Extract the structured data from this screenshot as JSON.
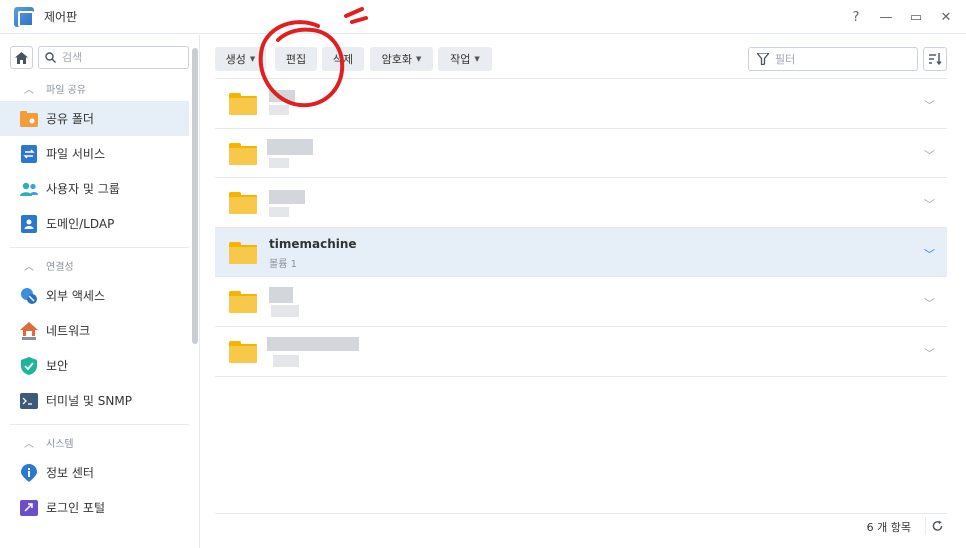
{
  "window": {
    "title": "제어판",
    "help_label": "?",
    "minimize_label": "—",
    "maximize_label": "▭",
    "close_label": "✕"
  },
  "sidebar": {
    "search_placeholder": "검색",
    "sections": [
      {
        "title": "파일 공유",
        "items": [
          {
            "label": "공유 폴더",
            "icon": "shared-folder-icon",
            "active": true
          },
          {
            "label": "파일 서비스",
            "icon": "file-services-icon"
          },
          {
            "label": "사용자 및 그룹",
            "icon": "users-icon"
          },
          {
            "label": "도메인/LDAP",
            "icon": "domain-icon"
          }
        ]
      },
      {
        "title": "연결성",
        "items": [
          {
            "label": "외부 액세스",
            "icon": "external-access-icon"
          },
          {
            "label": "네트워크",
            "icon": "network-icon"
          },
          {
            "label": "보안",
            "icon": "security-shield-icon"
          },
          {
            "label": "터미널 및 SNMP",
            "icon": "terminal-icon"
          }
        ]
      },
      {
        "title": "시스템",
        "items": [
          {
            "label": "정보 센터",
            "icon": "info-icon"
          },
          {
            "label": "로그인 포털",
            "icon": "login-portal-icon"
          }
        ]
      }
    ]
  },
  "toolbar": {
    "create_label": "생성",
    "edit_label": "편집",
    "delete_label": "삭제",
    "encrypt_label": "암호화",
    "action_label": "작업",
    "filter_placeholder": "필터"
  },
  "folders": [
    {
      "name": "",
      "sub": "",
      "redacted": true
    },
    {
      "name": "",
      "sub": "",
      "redacted": true
    },
    {
      "name": "",
      "sub": "",
      "redacted": true
    },
    {
      "name": "timemachine",
      "sub": "볼륨 1",
      "redacted": false,
      "selected": true
    },
    {
      "name": "",
      "sub": "",
      "redacted": true
    },
    {
      "name": "",
      "sub": "",
      "redacted": true
    }
  ],
  "footer": {
    "count_label": "6 개 항목"
  },
  "colors": {
    "accent": "#2d7fd8",
    "selection": "#e6eef7",
    "folder": "#f8c84a",
    "annotation": "#e02020"
  }
}
